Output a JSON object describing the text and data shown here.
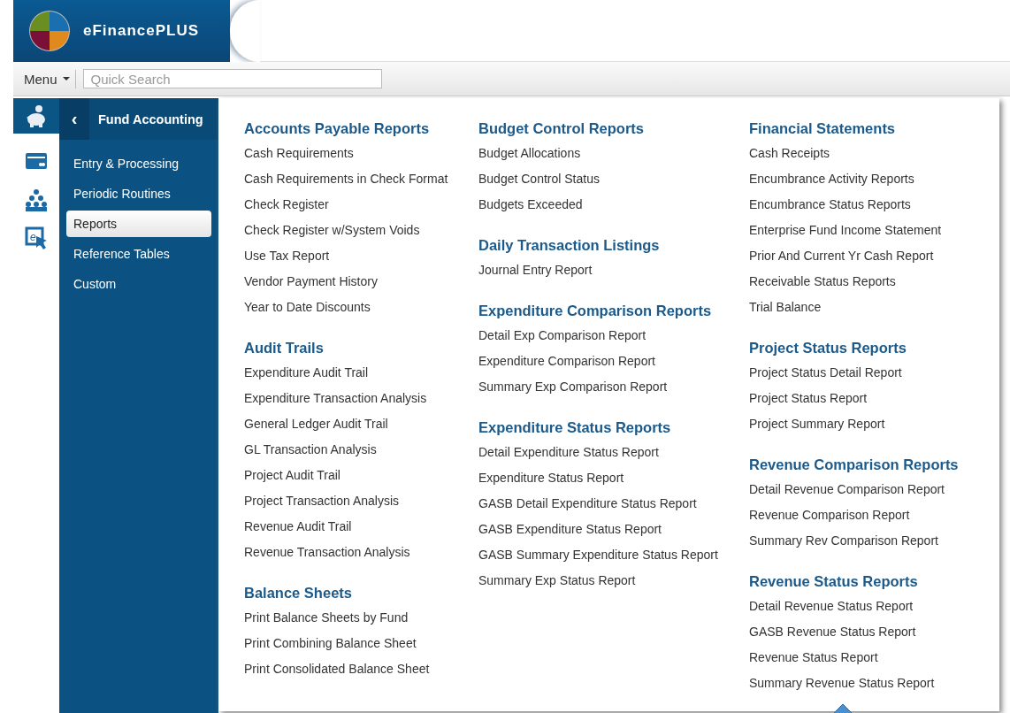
{
  "header": {
    "product_name": "eFinancePLUS"
  },
  "toolbar": {
    "menu_label": "Menu",
    "search": {
      "placeholder": "Quick Search"
    }
  },
  "app_icons": [
    {
      "kind": "piggy-bank",
      "selected": true
    },
    {
      "kind": "card",
      "selected": false
    },
    {
      "kind": "people",
      "selected": false
    },
    {
      "kind": "e-pointer",
      "selected": false,
      "glyph": "e"
    }
  ],
  "sidebar": {
    "title": "Fund Accounting",
    "back_icon": "‹",
    "items": [
      {
        "label": "Entry & Processing",
        "selected": false
      },
      {
        "label": "Periodic Routines",
        "selected": false
      },
      {
        "label": "Reports",
        "selected": true
      },
      {
        "label": "Reference Tables",
        "selected": false
      },
      {
        "label": "Custom",
        "selected": false
      }
    ]
  },
  "report_columns": [
    [
      {
        "title": "Accounts Payable Reports",
        "items": [
          "Cash Requirements",
          "Cash Requirements in Check Format",
          "Check Register",
          "Check Register w/System Voids",
          "Use Tax Report",
          "Vendor Payment History",
          "Year to Date Discounts"
        ]
      },
      {
        "title": "Audit Trails",
        "items": [
          "Expenditure Audit Trail",
          "Expenditure Transaction Analysis",
          "General Ledger Audit Trail",
          "GL Transaction Analysis",
          "Project Audit Trail",
          "Project Transaction Analysis",
          "Revenue Audit Trail",
          "Revenue Transaction Analysis"
        ]
      },
      {
        "title": "Balance Sheets",
        "items": [
          "Print Balance Sheets by Fund",
          "Print Combining Balance Sheet",
          "Print Consolidated Balance Sheet"
        ]
      }
    ],
    [
      {
        "title": "Budget Control Reports",
        "items": [
          "Budget Allocations",
          "Budget Control Status",
          "Budgets Exceeded"
        ]
      },
      {
        "title": "Daily Transaction Listings",
        "items": [
          "Journal Entry Report"
        ]
      },
      {
        "title": "Expenditure Comparison Reports",
        "items": [
          "Detail Exp Comparison Report",
          "Expenditure Comparison Report",
          "Summary Exp Comparison Report"
        ]
      },
      {
        "title": "Expenditure Status Reports",
        "items": [
          "Detail Expenditure Status Report",
          "Expenditure Status Report",
          "GASB Detail Expenditure Status Report",
          "GASB Expenditure Status Report",
          "GASB Summary Expenditure Status Report",
          "Summary Exp Status Report"
        ]
      }
    ],
    [
      {
        "title": "Financial Statements",
        "items": [
          "Cash Receipts",
          "Encumbrance Activity Reports",
          "Encumbrance Status Reports",
          "Enterprise Fund Income Statement",
          "Prior And Current Yr Cash Report",
          "Receivable Status Reports",
          "Trial Balance"
        ]
      },
      {
        "title": "Project Status Reports",
        "items": [
          "Project Status Detail Report",
          "Project Status Report",
          "Project Summary Report"
        ]
      },
      {
        "title": "Revenue Comparison Reports",
        "items": [
          "Detail Revenue Comparison Report",
          "Revenue Comparison Report",
          "Summary Rev Comparison Report"
        ]
      },
      {
        "title": "Revenue Status Reports",
        "items": [
          "Detail Revenue Status Report",
          "GASB Revenue Status Report",
          "Revenue Status Report",
          "Summary Revenue Status Report"
        ]
      }
    ]
  ]
}
